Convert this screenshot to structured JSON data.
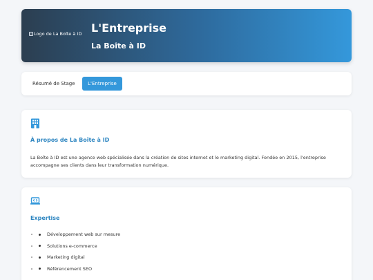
{
  "header": {
    "logo_alt": "Logo de La Boîte à ID",
    "title": "L'Entreprise",
    "subtitle": "La Boîte à ID"
  },
  "tabs": [
    {
      "label": "Résumé de Stage",
      "active": false
    },
    {
      "label": "L'Entreprise",
      "active": true
    }
  ],
  "about": {
    "icon": "building-icon",
    "title": "À propos de La Boîte à ID",
    "text": "La Boîte à ID est une agence web spécialisée dans la création de sites internet et le marketing digital. Fondée en 2015, l'entreprise accompagne ses clients dans leur transformation numérique."
  },
  "expertise": {
    "icon": "laptop-code-icon",
    "title": "Expertise",
    "items": [
      "Développement web sur mesure",
      "Solutions e-commerce",
      "Marketing digital",
      "Référencement SEO"
    ]
  },
  "colors": {
    "accent": "#3498db",
    "heading": "#2e86c1",
    "header_gradient_start": "#2c3e50",
    "header_gradient_end": "#3498db",
    "background": "#f4f6f9"
  }
}
